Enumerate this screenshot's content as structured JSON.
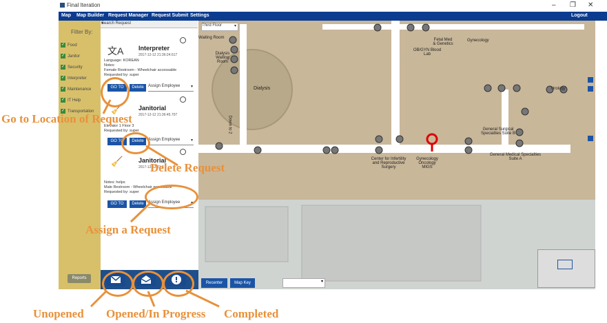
{
  "window": {
    "title": "Final Iteration"
  },
  "menu": [
    "Map",
    "Map Builder",
    "Request Manager",
    "Request Submit",
    "Settings"
  ],
  "logout": "Logout",
  "filter": {
    "heading": "Filter By:",
    "items": [
      "Food",
      "Janitor",
      "Security",
      "Interpreter",
      "Maintenance",
      "IT Help",
      "Transportation"
    ]
  },
  "reports": "Reports",
  "search": {
    "placeholder": "Search Request"
  },
  "floor": "Third Floor",
  "cards": [
    {
      "title": "Interpreter",
      "date": "2017-12-12 21:36:24.617",
      "lines": [
        "Language: KOREAN",
        "Notes:",
        "Female Restroom - Wheelchair accessable",
        "Requested by: super"
      ],
      "goto": "GO TO",
      "delete": "Delete",
      "assign": "Assign Employee"
    },
    {
      "title": "Janitorial",
      "date": "2017-12-12 21:36:45.707",
      "lines": [
        "Elevator 1 Floor 3",
        "Requested by: super"
      ],
      "goto": "GO TO",
      "delete": "Delete",
      "assign": "Assign Employee"
    },
    {
      "title": "Janitorial",
      "date": "2017-12-12 21:3",
      "lines": [
        "Notes: helps",
        "Male Restroom - Wheelchair accessable",
        "Requested by: super"
      ],
      "goto": "GO TO",
      "delete": "Delete",
      "assign": "Assign Employee"
    }
  ],
  "map_buttons": {
    "recenter": "Recenter",
    "mapkey": "Map Key"
  },
  "map_labels": [
    "Waiting Room",
    "Dialysis Waiting Room",
    "Dialysis",
    "Fetal Med & Genetics",
    "OB/GYN Blood Lab",
    "Gynecology",
    "Urology",
    "General Surgical Specialties Suite B",
    "General Medical Specialties Suite A",
    "Center for Infertility and Reproductive Surgery",
    "Gynecology Oncology MIGS",
    "Down to 2"
  ],
  "annotations": {
    "goto": "Go to Location of Request",
    "delete": "Delete Request",
    "assign": "Assign a Request",
    "unopened": "Unopened",
    "inprogress": "Opened/In Progress",
    "completed": "Completed"
  },
  "colors": {
    "accent": "#e8913a",
    "menubar": "#0b3c8f",
    "filter": "#d8c06a"
  }
}
